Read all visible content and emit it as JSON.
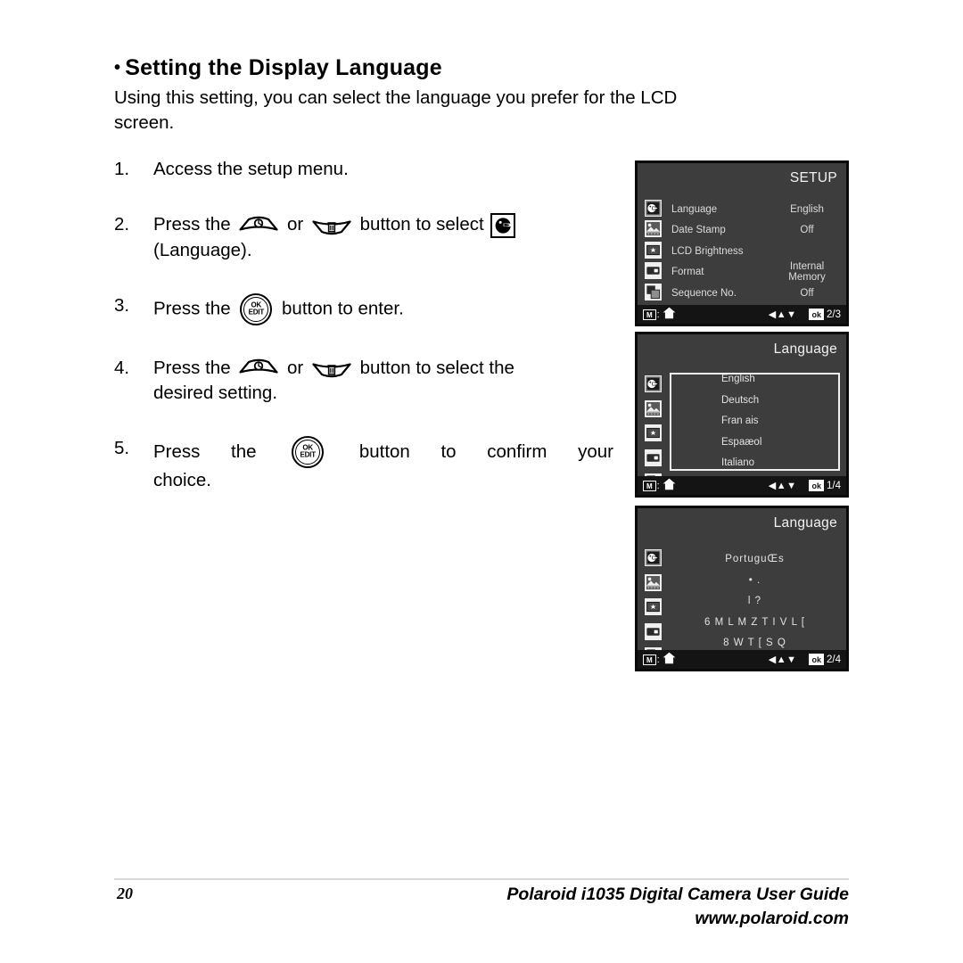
{
  "heading": {
    "bullet": "•",
    "title": "Setting the Display Language"
  },
  "intro": {
    "line1": "Using this setting, you can select the language you prefer for the LCD",
    "line2": "screen."
  },
  "steps": [
    {
      "num": "1.",
      "line1": "Access the setup menu."
    },
    {
      "num": "2.",
      "pre": "Press the",
      "or": "or",
      "mid": "button to select",
      "line2": "(Language)."
    },
    {
      "num": "3.",
      "pre": "Press the",
      "post": "button to enter."
    },
    {
      "num": "4.",
      "pre": "Press the",
      "or": "or",
      "mid": "button to select the",
      "line2": "desired setting."
    },
    {
      "num": "5.",
      "w1": "Press",
      "w2": "the",
      "w3": "button",
      "w4": "to",
      "w5": "confirm",
      "w6": "your",
      "line2": "choice."
    }
  ],
  "buttons": {
    "ok_label": "OK",
    "edit_label": "EDIT"
  },
  "lcd_screens": [
    {
      "title": "SETUP",
      "rows": [
        {
          "icon": "language-icon",
          "label": "Language",
          "value": "English"
        },
        {
          "icon": "date-stamp-icon",
          "label": "Date Stamp",
          "value": "Off"
        },
        {
          "icon": "lcd-brightness-icon",
          "label": "LCD Brightness",
          "value": ""
        },
        {
          "icon": "format-icon",
          "label": "Format",
          "value": "Internal Memory"
        },
        {
          "icon": "sequence-no-icon",
          "label": "Sequence No.",
          "value": "Off"
        }
      ],
      "footer": {
        "mode_label": "M",
        "separator": ":",
        "home_icon": "home-icon",
        "arrows": "◀▲▼",
        "ok_label": "ok",
        "page": "2/3"
      }
    },
    {
      "title": "Language",
      "rail_icons": [
        "language-icon",
        "date-stamp-icon",
        "lcd-brightness-icon",
        "format-icon",
        "sequence-no-icon"
      ],
      "boxed": true,
      "items": [
        "English",
        "Deutsch",
        "Fran ais",
        "Espaæol",
        "Italiano"
      ],
      "footer": {
        "mode_label": "M",
        "separator": ":",
        "home_icon": "home-icon",
        "arrows": "◀▲▼",
        "ok_label": "ok",
        "page": "1/4"
      }
    },
    {
      "title": "Language",
      "rail_icons": [
        "language-icon",
        "date-stamp-icon",
        "lcd-brightness-icon",
        "format-icon",
        "sequence-no-icon"
      ],
      "boxed": false,
      "items": [
        "PortuguŒs",
        "• .",
        "l ?",
        "6 M L M Z T I V L [",
        "8 W T [ S Q"
      ],
      "footer": {
        "mode_label": "M",
        "separator": ":",
        "home_icon": "home-icon",
        "arrows": "◀▲▼",
        "ok_label": "ok",
        "page": "2/4"
      }
    }
  ],
  "footer": {
    "page_number": "20",
    "guide_title": "Polaroid i1035 Digital Camera User Guide",
    "website": "www.polaroid.com"
  },
  "colors": {
    "lcd_background": "#3d3d3d",
    "lcd_frame": "#0a0a0a",
    "lcd_footer": "#141414",
    "lcd_text": "#e2e2e2",
    "page_background": "#ffffff"
  }
}
